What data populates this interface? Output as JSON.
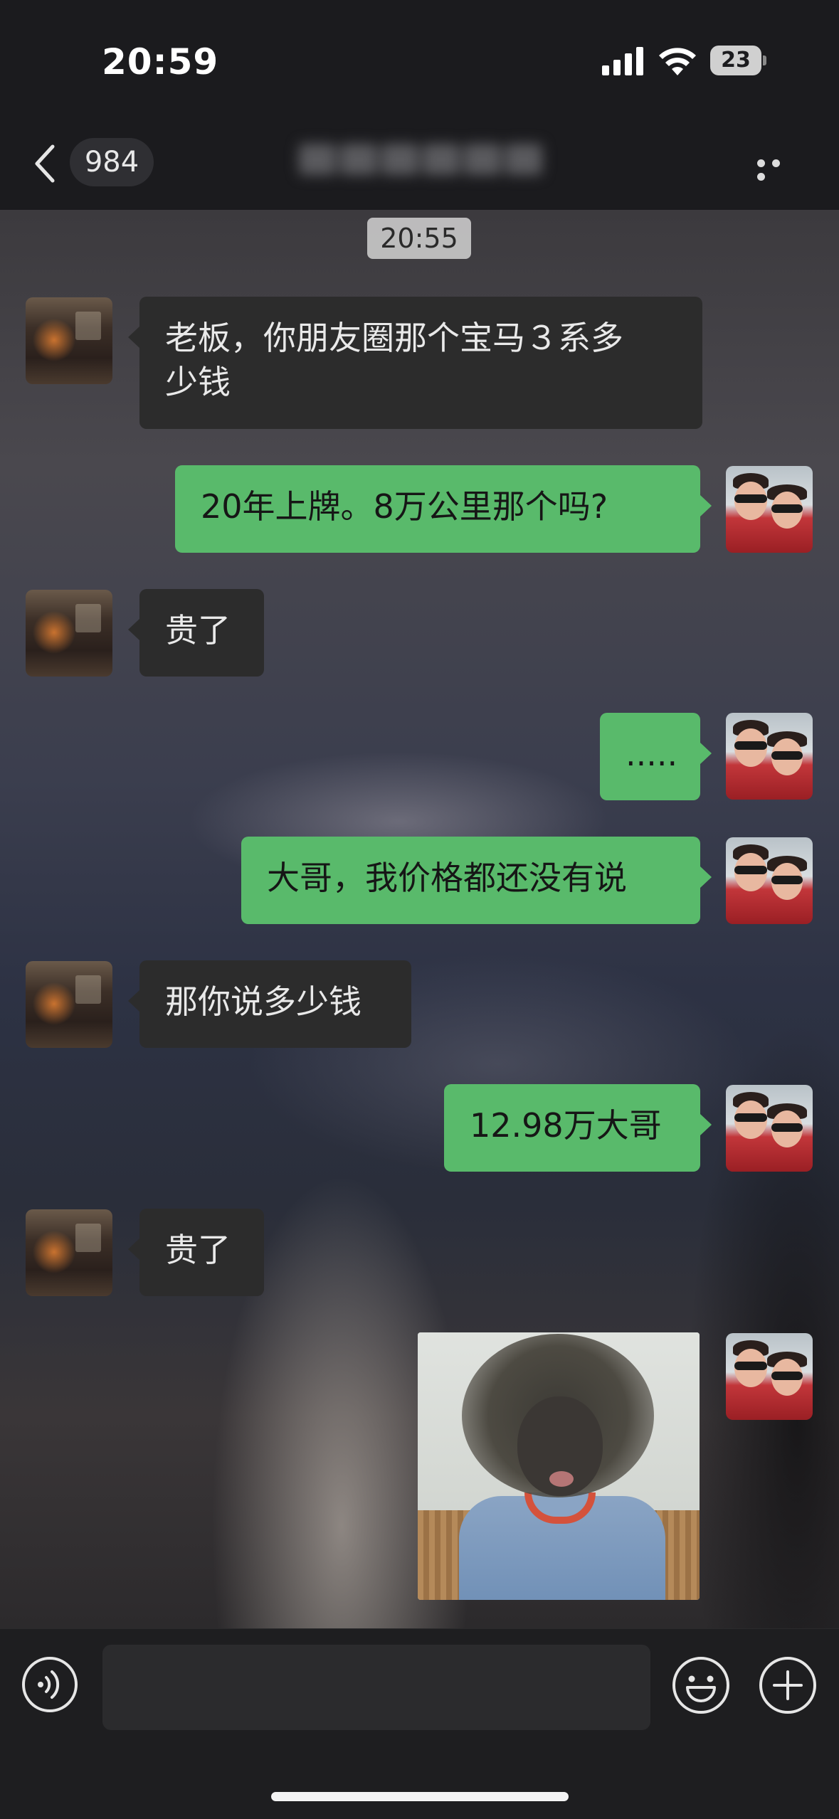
{
  "status_bar": {
    "time": "20:59",
    "battery": "23",
    "icons": [
      "cellular-signal-icon",
      "wifi-icon",
      "battery-icon"
    ]
  },
  "nav": {
    "unread_count": "984",
    "icons": [
      "back-chevron-icon",
      "more-dots-icon"
    ]
  },
  "chat": {
    "timestamp": "20:55",
    "messages": [
      {
        "side": "in",
        "type": "text",
        "text": "老板，你朋友圈那个宝马３系多\n少钱"
      },
      {
        "side": "out",
        "type": "text",
        "text": "20年上牌。8万公里那个吗?"
      },
      {
        "side": "in",
        "type": "text",
        "text": "贵了"
      },
      {
        "side": "out",
        "type": "text",
        "text": "....."
      },
      {
        "side": "out",
        "type": "text",
        "text": "大哥，我价格都还没有说"
      },
      {
        "side": "in",
        "type": "text",
        "text": "那你说多少钱"
      },
      {
        "side": "out",
        "type": "text",
        "text": "12.98万大哥"
      },
      {
        "side": "in",
        "type": "text",
        "text": "贵了"
      },
      {
        "side": "out",
        "type": "image"
      }
    ]
  },
  "input_bar": {
    "placeholder": "",
    "icons": [
      "voice-input-icon",
      "emoji-icon",
      "add-plus-icon"
    ]
  },
  "colors": {
    "outgoing_bubble": "#59ba6b",
    "incoming_bubble": "#2c2c2c",
    "bar_background": "#1b1b1e"
  }
}
